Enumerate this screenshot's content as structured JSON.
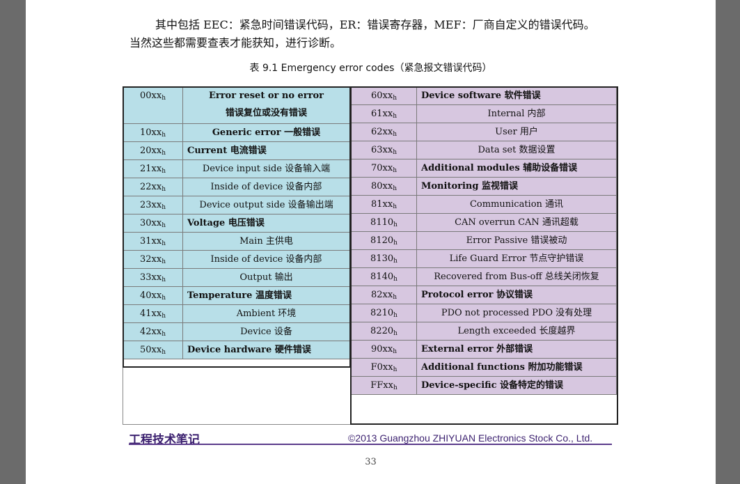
{
  "paragraph": {
    "line1": "其中包括 EEC：紧急时间错误代码，ER：错误寄存器，MEF：厂商自定义的错误代码。",
    "line2": "当然这些都需要查表才能获知，进行诊断。"
  },
  "caption": "表 9.1 Emergency error codes（紧急报文错误代码）",
  "left_table": {
    "r0": {
      "code": "00xx",
      "text1": "Error reset or no error",
      "text2": "错误复位或没有错误"
    },
    "r1": {
      "code": "10xx",
      "text": "Generic error 一般错误"
    },
    "r2": {
      "code": "20xx",
      "text": "Current 电流错误"
    },
    "r3": {
      "code": "21xx",
      "text": "Device input side 设备输入端"
    },
    "r4": {
      "code": "22xx",
      "text": "Inside of device 设备内部"
    },
    "r5": {
      "code": "23xx",
      "text": "Device output side 设备输出端"
    },
    "r6": {
      "code": "30xx",
      "text": "Voltage 电压错误"
    },
    "r7": {
      "code": "31xx",
      "text": "Main 主供电"
    },
    "r8": {
      "code": "32xx",
      "text": "Inside of device 设备内部"
    },
    "r9": {
      "code": "33xx",
      "text": "Output 输出"
    },
    "r10": {
      "code": "40xx",
      "text": "Temperature 温度错误"
    },
    "r11": {
      "code": "41xx",
      "text": "Ambient 环境"
    },
    "r12": {
      "code": "42xx",
      "text": "Device 设备"
    },
    "r13": {
      "code": "50xx",
      "text": "Device hardware 硬件错误"
    }
  },
  "right_table": {
    "r0": {
      "code": "60xx",
      "text": "Device software 软件错误"
    },
    "r1": {
      "code": "61xx",
      "text": "Internal 内部"
    },
    "r2": {
      "code": "62xx",
      "text": "User 用户"
    },
    "r3": {
      "code": "63xx",
      "text": "Data set 数据设置"
    },
    "r4": {
      "code": "70xx",
      "text": "Additional modules 辅助设备错误"
    },
    "r5": {
      "code": "80xx",
      "text": "Monitoring 监视错误"
    },
    "r6": {
      "code": "81xx",
      "text": "Communication 通讯"
    },
    "r7": {
      "code": "8110",
      "text": "CAN overrun CAN 通讯超载"
    },
    "r8": {
      "code": "8120",
      "text": "Error Passive 错误被动"
    },
    "r9": {
      "code": "8130",
      "text": "Life Guard Error 节点守护错误"
    },
    "r10": {
      "code": "8140",
      "text": "Recovered from Bus-off 总线关闭恢复"
    },
    "r11": {
      "code": "82xx",
      "text": "Protocol error 协议错误"
    },
    "r12": {
      "code": "8210",
      "text": "PDO not processed PDO 没有处理"
    },
    "r13": {
      "code": "8220",
      "text": "Length exceeded 长度越界"
    },
    "r14": {
      "code": "90xx",
      "text": "External error 外部错误"
    },
    "r15": {
      "code": "F0xx",
      "text": "Additional functions 附加功能错误"
    },
    "r16": {
      "code": "FFxx",
      "text": "Device-specific 设备特定的错误"
    }
  },
  "hex_suffix": "h",
  "footer": {
    "left": "工程技术笔记",
    "right": "©2013 Guangzhou ZHIYUAN Electronics Stock Co., Ltd."
  },
  "page_number": "33"
}
